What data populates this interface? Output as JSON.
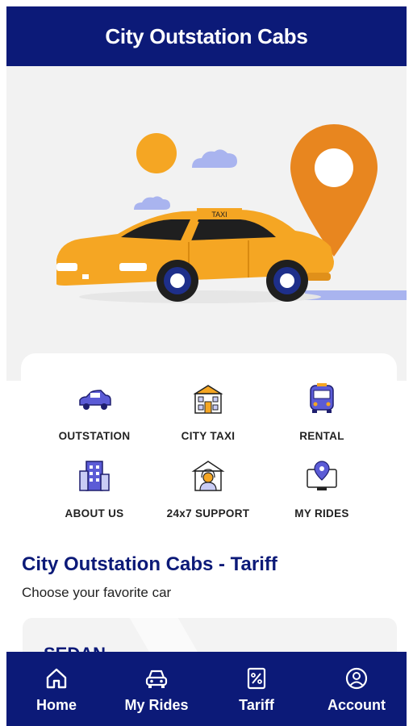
{
  "app": {
    "title": "City Outstation Cabs"
  },
  "hero": {
    "taxi_sign": "TAXI"
  },
  "services": [
    {
      "label": "OUTSTATION",
      "icon": "car-icon"
    },
    {
      "label": "CITY TAXI",
      "icon": "building-icon"
    },
    {
      "label": "RENTAL",
      "icon": "bus-icon"
    },
    {
      "label": "ABOUT US",
      "icon": "office-building-icon"
    },
    {
      "label": "24x7 SUPPORT",
      "icon": "support-agent-icon"
    },
    {
      "label": "MY RIDES",
      "icon": "map-pin-screen-icon"
    }
  ],
  "tariff": {
    "title": "City Outstation Cabs - Tariff",
    "subtitle": "Choose your favorite car",
    "first_car": "SEDAN"
  },
  "nav": [
    {
      "label": "Home",
      "icon": "home-icon"
    },
    {
      "label": "My Rides",
      "icon": "car-front-icon"
    },
    {
      "label": "Tariff",
      "icon": "percent-doc-icon"
    },
    {
      "label": "Account",
      "icon": "user-circle-icon"
    }
  ],
  "colors": {
    "primary": "#0c1a78",
    "accent_orange": "#f5a623",
    "pin_orange": "#e8861f",
    "icon_purple": "#5b5bd6"
  }
}
